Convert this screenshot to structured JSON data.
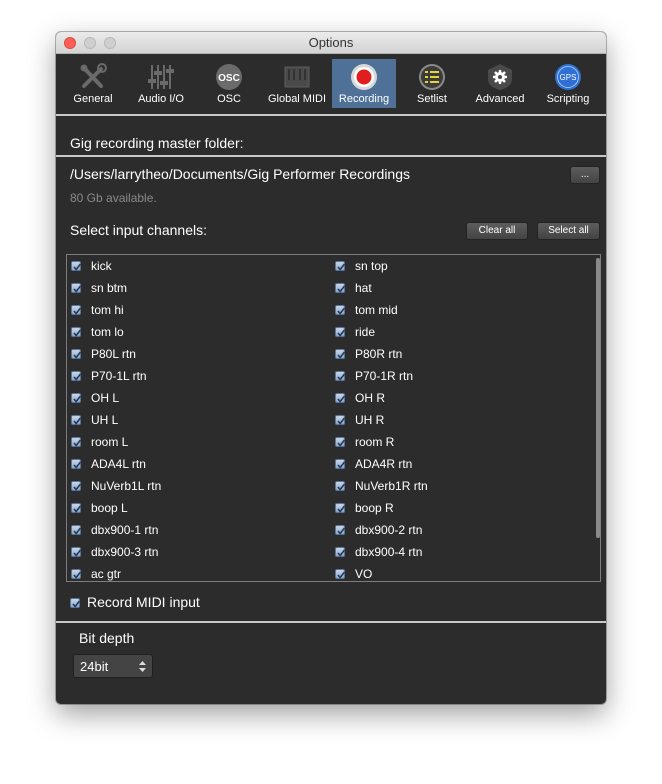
{
  "window": {
    "title": "Options"
  },
  "tabs": [
    {
      "label": "General",
      "icon": "tools-icon"
    },
    {
      "label": "Audio I/O",
      "icon": "faders-icon"
    },
    {
      "label": "OSC",
      "icon": "osc-icon"
    },
    {
      "label": "Global MIDI",
      "icon": "midi-keyboard-icon"
    },
    {
      "label": "Recording",
      "icon": "record-icon",
      "active": true
    },
    {
      "label": "Setlist",
      "icon": "setlist-icon"
    },
    {
      "label": "Advanced",
      "icon": "gear-shield-icon"
    },
    {
      "label": "Scripting",
      "icon": "gps-icon"
    }
  ],
  "osc_icon_text": "OSC",
  "gps_icon_text": "GPS",
  "recording": {
    "folder_heading": "Gig recording master folder:",
    "folder_path": "/Users/larrytheo/Documents/Gig Performer Recordings",
    "browse_label": "...",
    "available": "80 Gb available.",
    "channels_heading": "Select input channels:",
    "clear_all": "Clear all",
    "select_all": "Select all",
    "channels_left": [
      "kick",
      "sn btm",
      "tom hi",
      "tom lo",
      "P80L rtn",
      "P70-1L rtn",
      "OH L",
      "UH L",
      "room L",
      "ADA4L rtn",
      "NuVerb1L rtn",
      "boop L",
      "dbx900-1 rtn",
      "dbx900-3 rtn",
      "ac gtr"
    ],
    "channels_right": [
      "sn top",
      "hat",
      "tom mid",
      "ride",
      "P80R rtn",
      "P70-1R rtn",
      "OH R",
      "UH R",
      "room R",
      "ADA4R rtn",
      "NuVerb1R rtn",
      "boop R",
      "dbx900-2 rtn",
      "dbx900-4 rtn",
      "VO"
    ],
    "record_midi_label": "Record MIDI input",
    "record_midi_checked": true,
    "bit_depth_label": "Bit depth",
    "bit_depth_value": "24bit"
  },
  "colors": {
    "background": "#2c2c2c",
    "active_tab": "#4f7197",
    "record_red": "#e11d1d",
    "setlist_yellow": "#e6d23a",
    "gps_blue": "#2f6fd6"
  }
}
